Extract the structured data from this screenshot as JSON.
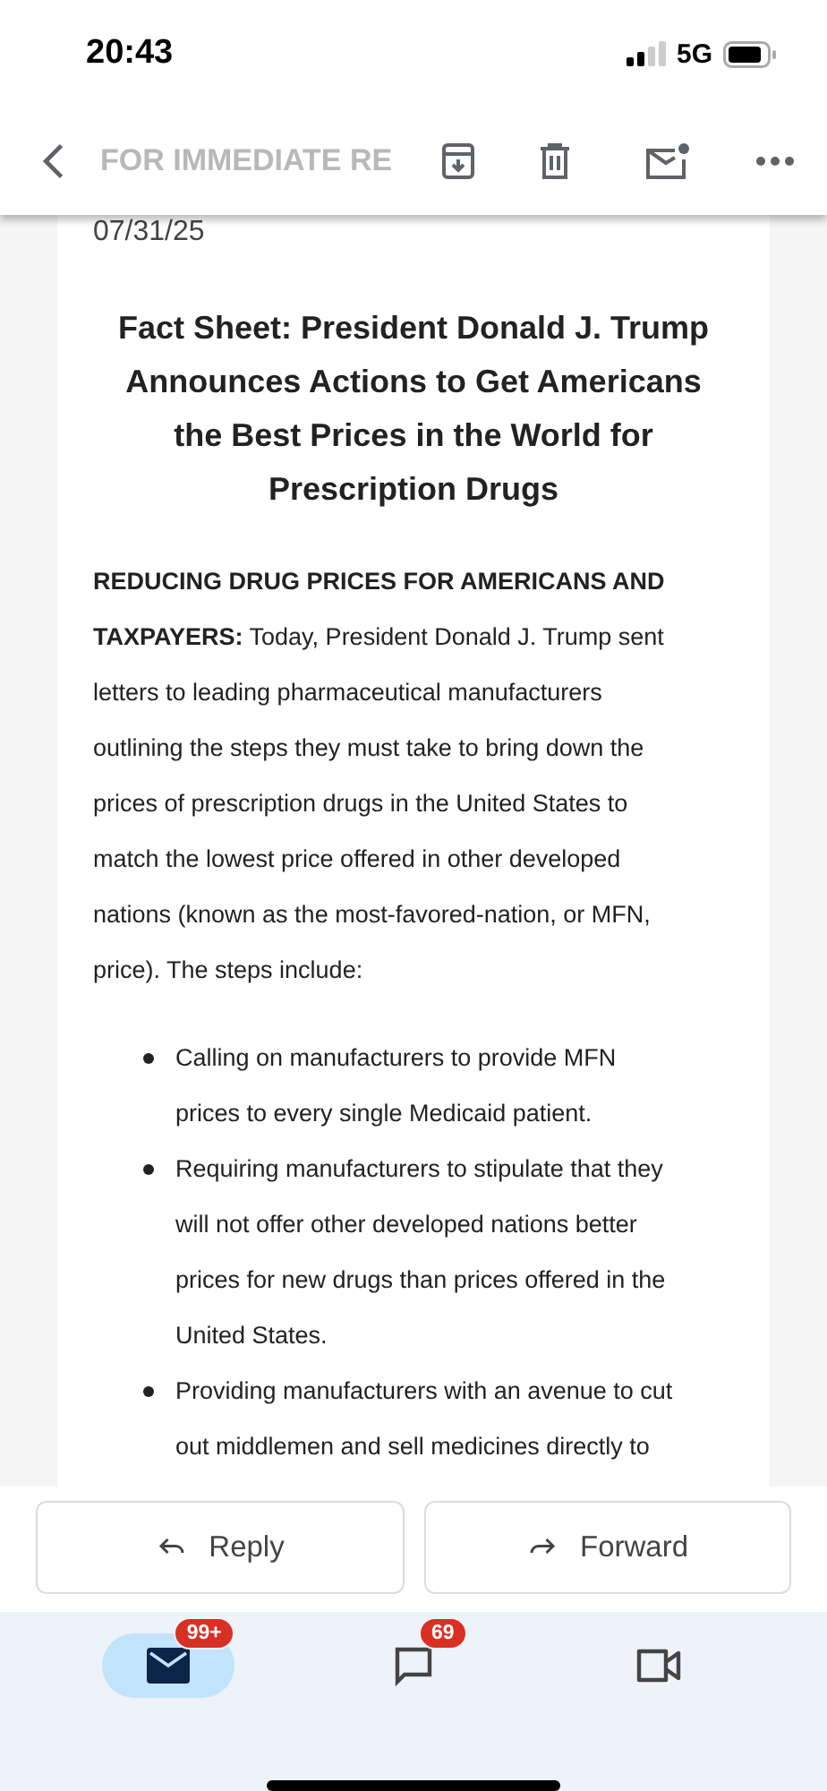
{
  "status_bar": {
    "time": "20:43",
    "network": "5G"
  },
  "toolbar": {
    "faded_heading": "FOR IMMEDIATE RE"
  },
  "email": {
    "date": "07/31/25",
    "title": "Fact Sheet: President Donald J. Trump Announces Actions to Get Americans the Best Prices in the World for Prescription Drugs",
    "paragraph_lines": [
      "**REDUCING DRUG PRICES FOR AMERICANS AND**",
      "**TAXPAYERS:** Today, President Donald J. Trump sent",
      "letters to leading pharmaceutical manufacturers",
      "outlining the steps they must take to bring down the",
      "prices of prescription drugs in the United States to",
      "match the lowest price offered in other developed",
      "nations (known as the most-favored-nation, or MFN,",
      "price). The steps include:"
    ],
    "bullets": [
      {
        "lines": [
          "Calling on manufacturers to provide MFN",
          "prices to every single Medicaid patient."
        ]
      },
      {
        "lines": [
          "Requiring manufacturers to stipulate that they",
          "will not offer other developed nations better",
          "prices for new drugs than prices offered in the",
          "United States."
        ]
      },
      {
        "lines": [
          "Providing manufacturers with an avenue to cut",
          "out middlemen and sell medicines directly to"
        ]
      }
    ]
  },
  "actions": [
    {
      "kind": "reply",
      "label": "Reply"
    },
    {
      "kind": "forward",
      "label": "Forward"
    }
  ],
  "bottom_nav": [
    {
      "kind": "mail",
      "badge": "99+",
      "selected": true
    },
    {
      "kind": "chat",
      "badge": "69",
      "selected": false
    },
    {
      "kind": "video",
      "selected": false
    }
  ]
}
